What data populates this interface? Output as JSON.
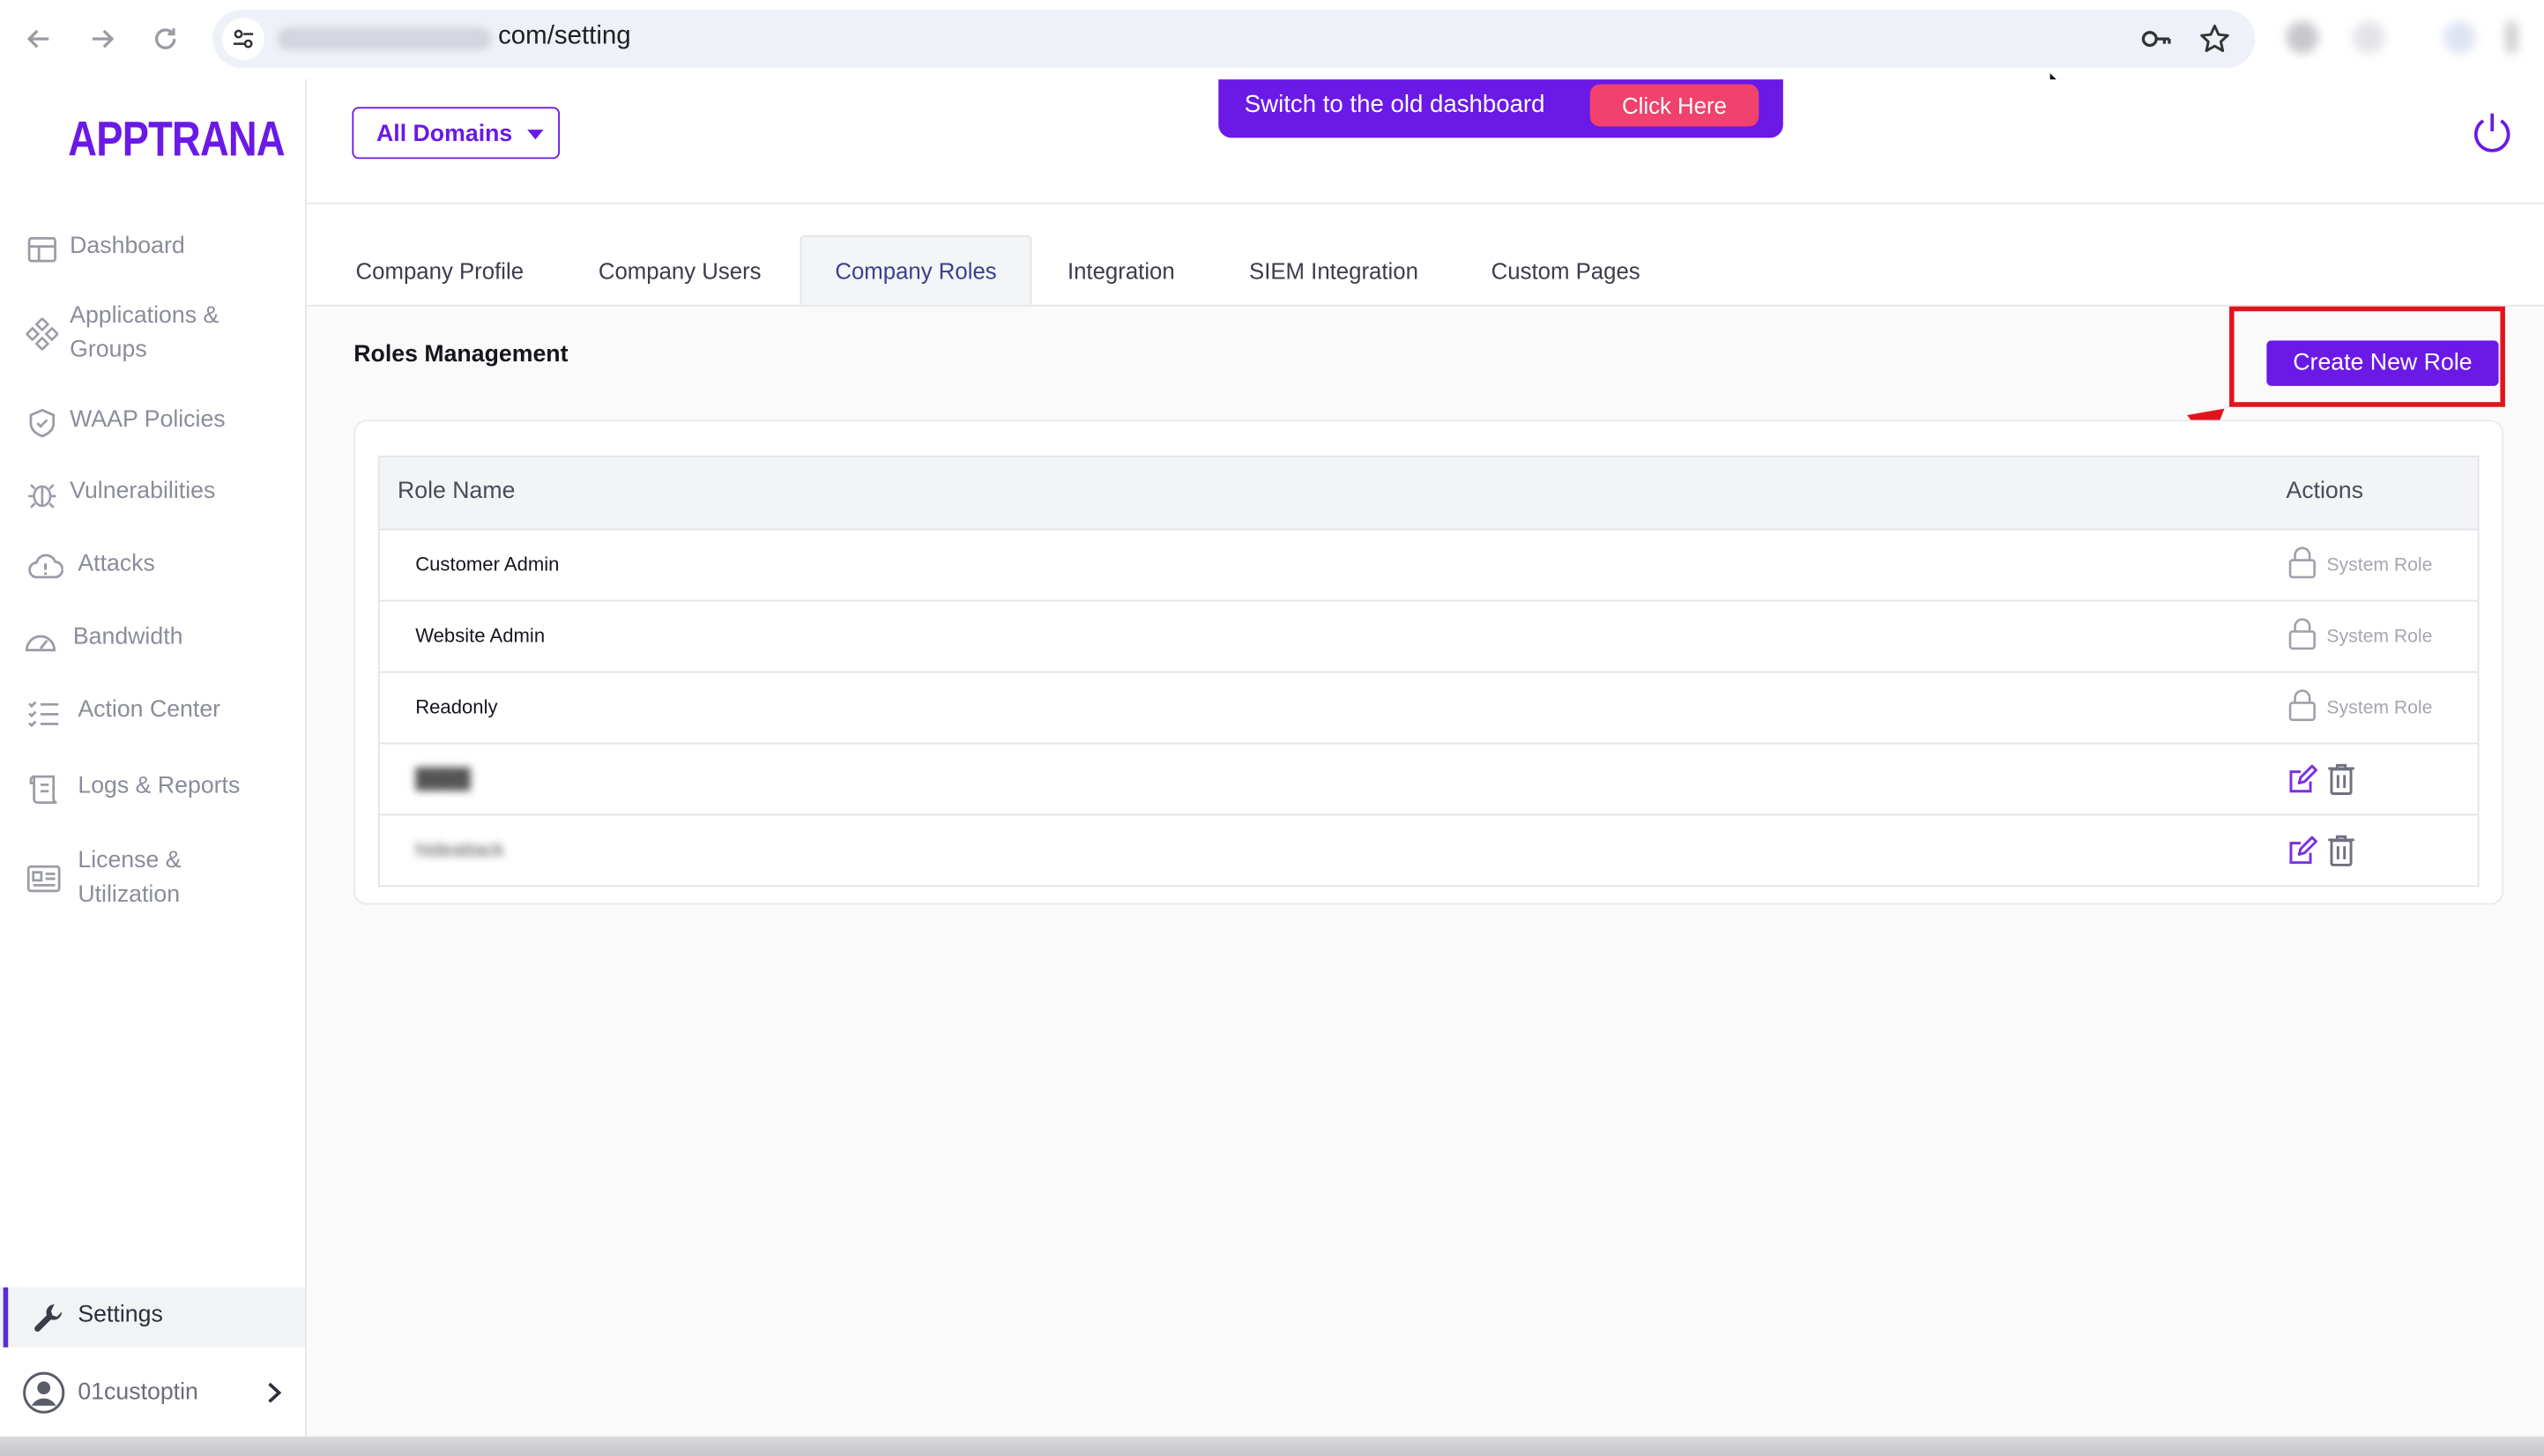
{
  "browser": {
    "url_visible": "com/setting",
    "icons": [
      "back-arrow-icon",
      "forward-arrow-icon",
      "reload-icon",
      "site-settings-icon",
      "key-icon",
      "star-icon"
    ]
  },
  "sidebar": {
    "logo": "APPTRANA",
    "items": [
      {
        "label": "Dashboard",
        "icon": "dashboard-icon"
      },
      {
        "label": "Applications &",
        "label2": "Groups",
        "icon": "applications-icon"
      },
      {
        "label": "WAAP Policies",
        "icon": "shield-icon"
      },
      {
        "label": "Vulnerabilities",
        "icon": "bug-icon"
      },
      {
        "label": "Attacks",
        "icon": "cloud-alert-icon"
      },
      {
        "label": "Bandwidth",
        "icon": "gauge-icon"
      },
      {
        "label": "Action Center",
        "icon": "checklist-icon"
      },
      {
        "label": "Logs & Reports",
        "icon": "scroll-icon"
      },
      {
        "label": "License &",
        "label2": "Utilization",
        "icon": "license-icon"
      }
    ],
    "settings_label": "Settings",
    "user_label": "01custoptin"
  },
  "header": {
    "domain_select": "All Domains",
    "banner_text": "Switch to the old dashboard",
    "banner_button": "Click Here"
  },
  "tabs": [
    {
      "label": "Company Profile",
      "active": false
    },
    {
      "label": "Company Users",
      "active": false
    },
    {
      "label": "Company Roles",
      "active": true
    },
    {
      "label": "Integration",
      "active": false
    },
    {
      "label": "SIEM Integration",
      "active": false
    },
    {
      "label": "Custom Pages",
      "active": false
    }
  ],
  "main": {
    "title": "Roles Management",
    "create_button": "Create New Role",
    "table": {
      "headers": {
        "name": "Role Name",
        "actions": "Actions"
      },
      "rows": [
        {
          "name": "Customer Admin",
          "system": true,
          "system_label": "System Role"
        },
        {
          "name": "Website Admin",
          "system": true,
          "system_label": "System Role"
        },
        {
          "name": "Readonly",
          "system": true,
          "system_label": "System Role"
        },
        {
          "name": "████",
          "system": false,
          "blurred": true
        },
        {
          "name": "hideattack",
          "system": false,
          "blurred": true
        }
      ]
    }
  },
  "colors": {
    "brand": "#6a19e6",
    "banner_button": "#f0426c",
    "annotation_red": "#e2141b"
  }
}
